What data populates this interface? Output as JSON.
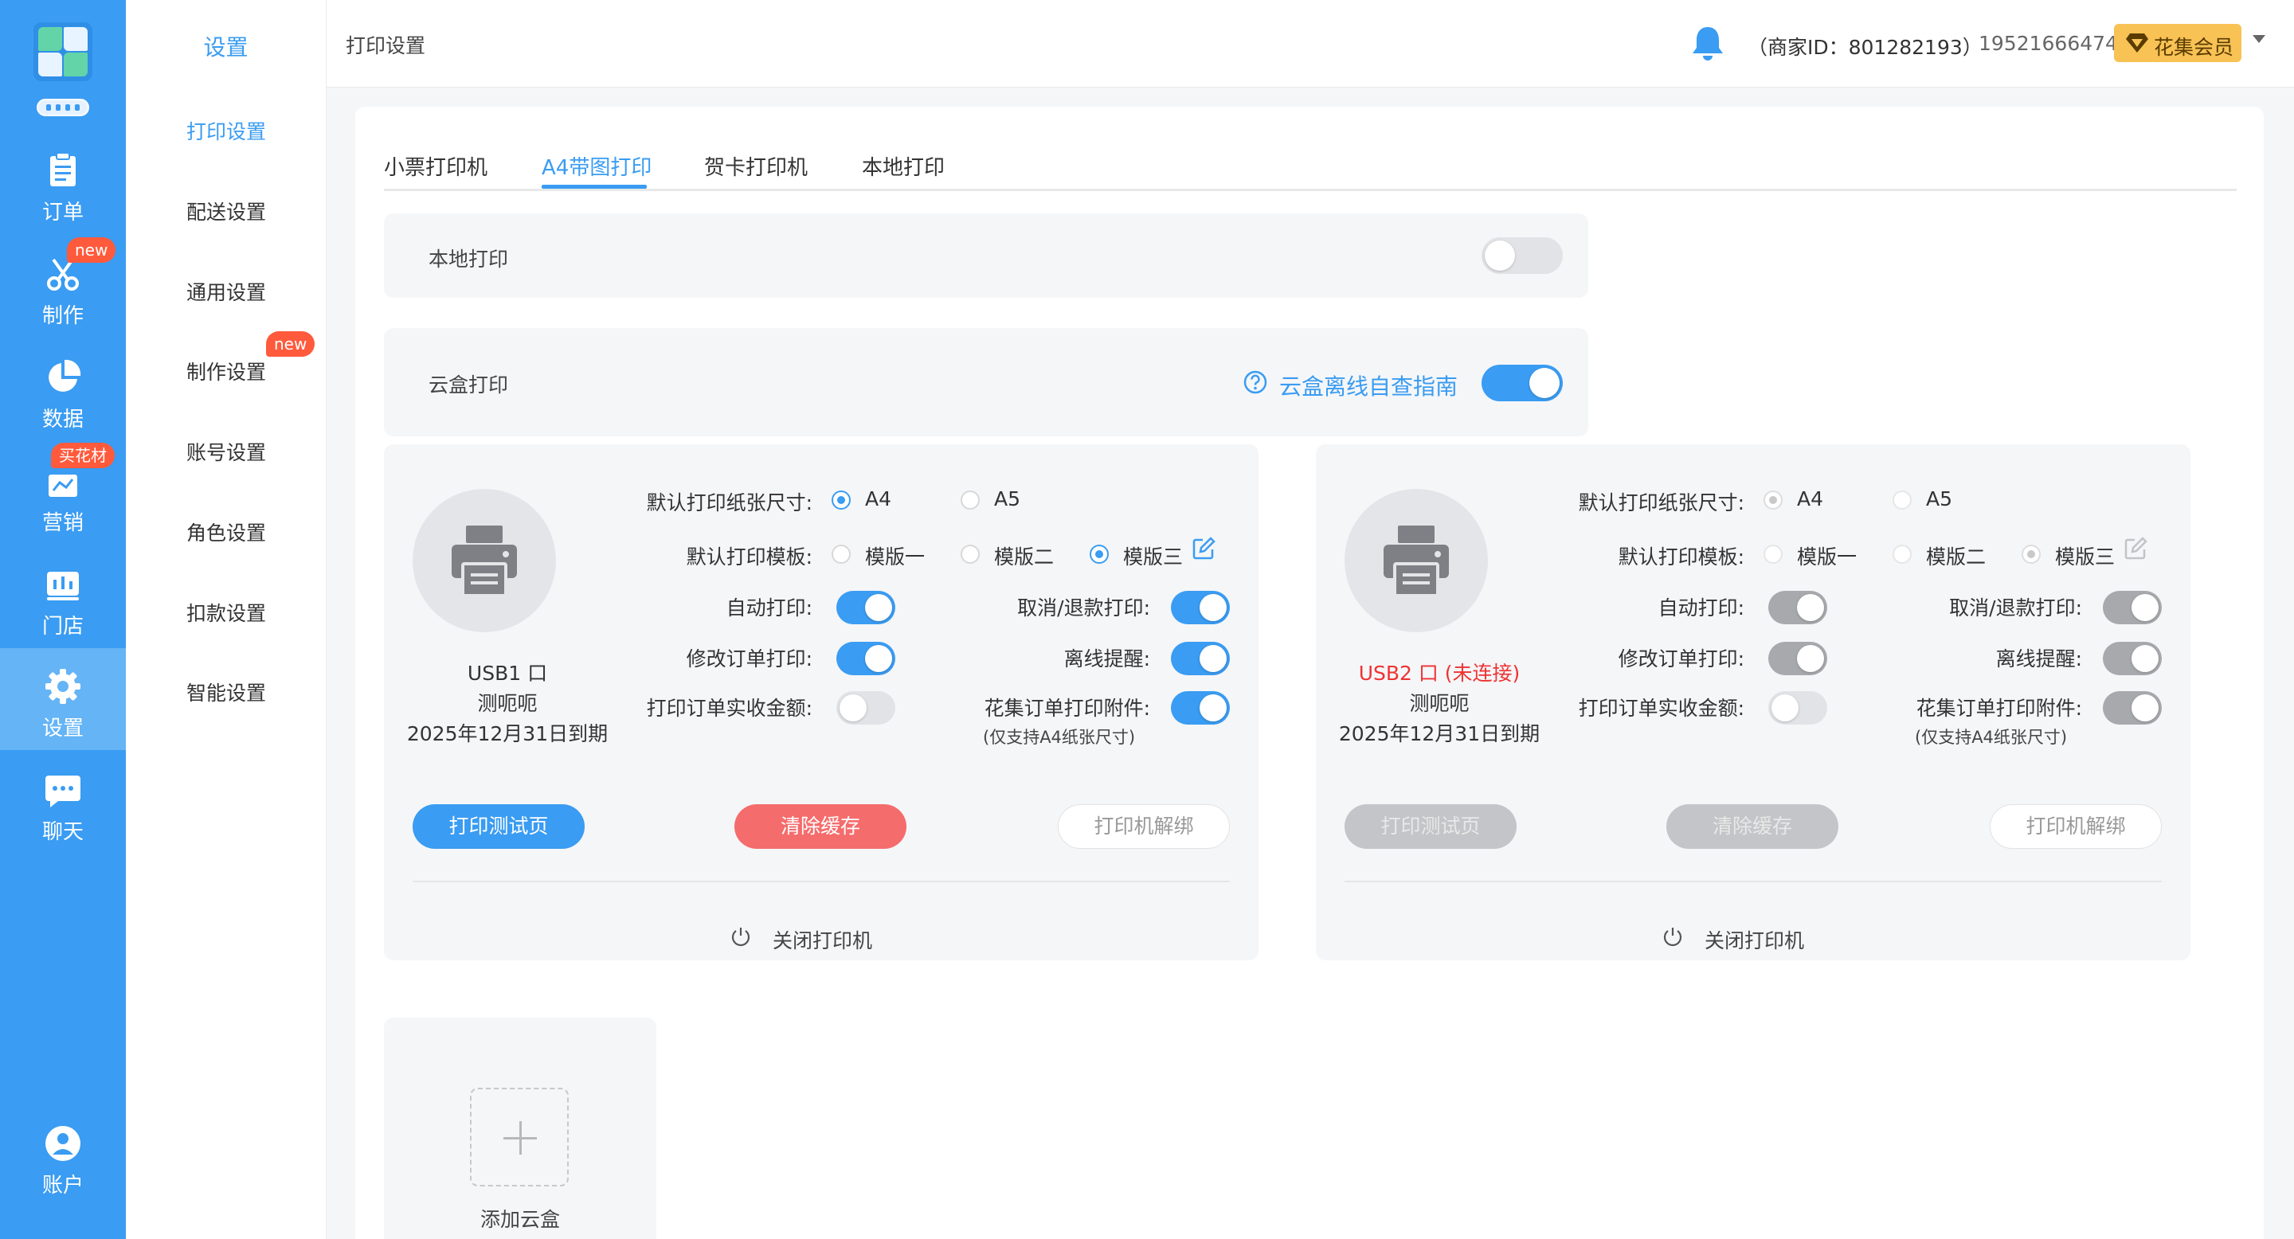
{
  "nav": {
    "items": [
      {
        "label": "订单",
        "icon": "clipboard-icon"
      },
      {
        "label": "制作",
        "icon": "scissors-icon",
        "badge": "new"
      },
      {
        "label": "数据",
        "icon": "pie-chart-icon"
      },
      {
        "label": "营销",
        "icon": "marketing-chart-icon",
        "badge": "买花材"
      },
      {
        "label": "门店",
        "icon": "store-icon"
      },
      {
        "label": "设置",
        "icon": "gear-icon",
        "active": true
      },
      {
        "label": "聊天",
        "icon": "chat-icon"
      },
      {
        "label": "账户",
        "icon": "user-icon"
      }
    ]
  },
  "subnav": {
    "title": "设置",
    "items": [
      "打印设置",
      "配送设置",
      "通用设置",
      "制作设置",
      "账号设置",
      "角色设置",
      "扣款设置",
      "智能设置"
    ],
    "active": "打印设置",
    "badge": "new"
  },
  "header": {
    "title": "打印设置",
    "merchant": "（商家ID：801282193）",
    "phone": "19521666474",
    "member": "花集会员"
  },
  "tabs": [
    "小票打印机",
    "A4带图打印",
    "贺卡打印机",
    "本地打印"
  ],
  "active_tab": "A4带图打印",
  "local_print": {
    "label": "本地打印",
    "enabled": false
  },
  "cloud_print": {
    "label": "云盒打印",
    "guide": "云盒离线自查指南",
    "enabled": true
  },
  "printer_labels": {
    "paper_size": "默认打印纸张尺寸:",
    "paper_a4": "A4",
    "paper_a5": "A5",
    "template": "默认打印模板:",
    "tpl1": "模版一",
    "tpl2": "模版二",
    "tpl3": "模版三",
    "auto_print": "自动打印:",
    "cancel_print": "取消/退款打印:",
    "modify_print": "修改订单打印:",
    "offline_alert": "离线提醒:",
    "amount_print": "打印订单实收金额:",
    "attach_print": "花集订单打印附件:",
    "attach_note": "(仅支持A4纸张尺寸)",
    "btn_test": "打印测试页",
    "btn_clear": "清除缓存",
    "btn_unbind": "打印机解绑",
    "power_off": "关闭打印机"
  },
  "printers": [
    {
      "name": "USB1 口",
      "alias": "测呃呃",
      "expire": "2025年12月31日到期",
      "connected": true,
      "paper": "A4",
      "template": "模版三",
      "auto_print": true,
      "cancel_print": true,
      "modify_print": true,
      "offline_alert": true,
      "amount_print": false,
      "attach_print": true
    },
    {
      "name": "USB2 口 (未连接)",
      "alias": "测呃呃",
      "expire": "2025年12月31日到期",
      "connected": false,
      "paper": "A4",
      "template": "模版三",
      "auto_print": true,
      "cancel_print": true,
      "modify_print": true,
      "offline_alert": true,
      "amount_print": false,
      "attach_print": true
    }
  ],
  "add_box": "添加云盒",
  "colors": {
    "primary": "#3a9cf2",
    "danger": "#f56c6c",
    "badge": "#ff5a3c",
    "member": "#f8c255"
  }
}
